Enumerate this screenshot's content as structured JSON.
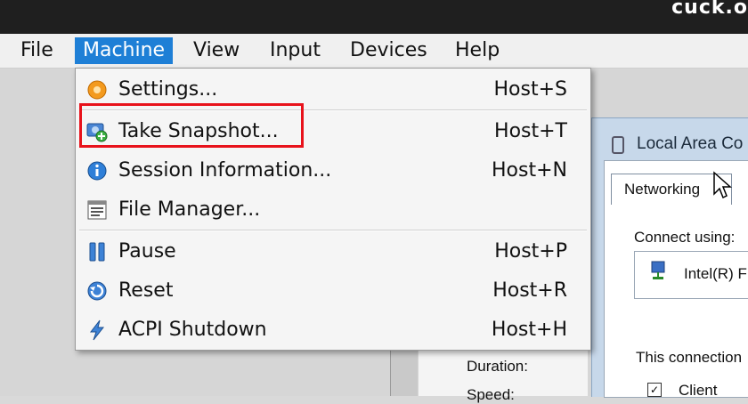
{
  "window": {
    "title_fragment": "cuck.o"
  },
  "menubar": {
    "items": [
      {
        "label": "File"
      },
      {
        "label": "Machine",
        "active": true
      },
      {
        "label": "View"
      },
      {
        "label": "Input"
      },
      {
        "label": "Devices"
      },
      {
        "label": "Help"
      }
    ]
  },
  "machine_menu": {
    "items": [
      {
        "label": "Settings...",
        "shortcut": "Host+S",
        "icon": "gear-icon"
      },
      {
        "label": "Take Snapshot...",
        "shortcut": "Host+T",
        "icon": "snapshot-icon",
        "highlighted": true
      },
      {
        "label": "Session Information...",
        "shortcut": "Host+N",
        "icon": "info-icon"
      },
      {
        "label": "File Manager...",
        "shortcut": "",
        "icon": "file-manager-icon"
      },
      {
        "label": "Pause",
        "shortcut": "Host+P",
        "icon": "pause-icon"
      },
      {
        "label": "Reset",
        "shortcut": "Host+R",
        "icon": "reset-icon"
      },
      {
        "label": "ACPI Shutdown",
        "shortcut": "Host+H",
        "icon": "acpi-shutdown-icon"
      }
    ]
  },
  "guest": {
    "network_window_title": "Local Area Co",
    "tab_label": "Networking",
    "connect_using_label": "Connect using:",
    "adapter_name": "Intel(R) F",
    "connection_label": "This connection",
    "client_item": "Client",
    "duration_label": "Duration:",
    "speed_label": "Speed:"
  },
  "colors": {
    "menu_active": "#1e7fd6",
    "highlight_box": "#e8121b"
  }
}
